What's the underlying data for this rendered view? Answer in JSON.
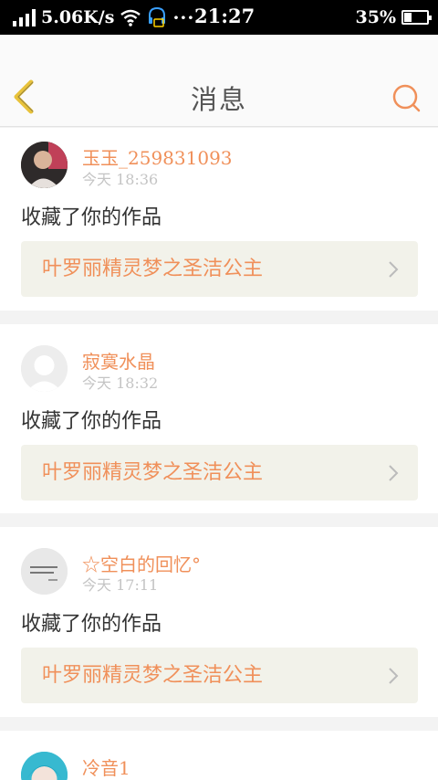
{
  "status_bar": {
    "network_speed": "5.06K/s",
    "more_indicator": "···",
    "time": "21:27",
    "battery_percent": "35%",
    "battery_level": 0.35,
    "icons": [
      "signal-icon",
      "wifi-icon",
      "headset-notification-icon",
      "battery-icon"
    ]
  },
  "nav": {
    "title": "消息",
    "back_icon": "chevron-left-icon",
    "search_icon": "search-icon",
    "accent_color": "#f0905a",
    "back_color": "#e8c23a"
  },
  "messages": [
    {
      "user": "玉玉_259831093",
      "time": "今天 18:36",
      "action": "收藏了你的作品",
      "work_title": "叶罗丽精灵梦之圣洁公主",
      "avatar": "photo"
    },
    {
      "user": "寂寞水晶",
      "time": "今天 18:32",
      "action": "收藏了你的作品",
      "work_title": "叶罗丽精灵梦之圣洁公主",
      "avatar": "default"
    },
    {
      "user": "☆空白的回忆°",
      "time": "今天 17:11",
      "action": "收藏了你的作品",
      "work_title": "叶罗丽精灵梦之圣洁公主",
      "avatar": "text"
    },
    {
      "user": "冷音1",
      "time": "",
      "action": "",
      "work_title": "",
      "avatar": "anime"
    }
  ]
}
